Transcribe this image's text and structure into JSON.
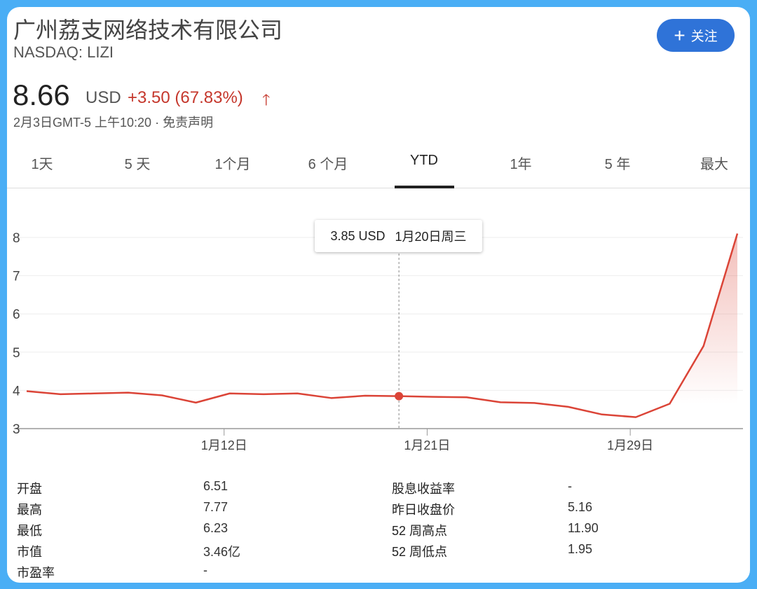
{
  "header": {
    "company": "广州荔支网络技术有限公司",
    "ticker": "NASDAQ: LIZI",
    "price": "8.66",
    "currency": "USD",
    "change": "+3.50 (67.83%)",
    "change_icon": "arrow-up-icon",
    "timestamp": "2月3日GMT-5 上午10:20 · 免责声明",
    "follow_label": "关注",
    "follow_icon": "plus-icon"
  },
  "colors": {
    "accent": "#2f73d8",
    "negative_up": "#c5372c",
    "line": "#db4437",
    "frame": "#4aaef5"
  },
  "tabs": [
    {
      "label": "1天"
    },
    {
      "label": "5 天"
    },
    {
      "label": "1个月"
    },
    {
      "label": "6 个月"
    },
    {
      "label": "YTD",
      "active": true
    },
    {
      "label": "1年"
    },
    {
      "label": "5 年"
    },
    {
      "label": "最大"
    }
  ],
  "tooltip": {
    "price": "3.85 USD",
    "date": "1月20日周三"
  },
  "chart_data": {
    "type": "line",
    "title": "",
    "xlabel": "",
    "ylabel": "",
    "ylim": [
      3,
      8
    ],
    "yticks": [
      "3",
      "4",
      "5",
      "6",
      "7",
      "8"
    ],
    "xticks": [
      {
        "label": "1月12日",
        "index": 6
      },
      {
        "label": "1月21日",
        "index": 12
      },
      {
        "label": "1月29日",
        "index": 18
      }
    ],
    "x": [
      "1/4",
      "1/5",
      "1/6",
      "1/7",
      "1/8",
      "1/11",
      "1/12",
      "1/13",
      "1/14",
      "1/15",
      "1/19",
      "1/20",
      "1/21",
      "1/22",
      "1/25",
      "1/26",
      "1/27",
      "1/28",
      "1/29",
      "2/1",
      "2/2",
      "2/3"
    ],
    "series": [
      {
        "name": "LIZI",
        "values": [
          3.98,
          3.9,
          3.92,
          3.94,
          3.87,
          3.68,
          3.92,
          3.9,
          3.92,
          3.8,
          3.86,
          3.85,
          3.83,
          3.82,
          3.69,
          3.67,
          3.57,
          3.37,
          3.3,
          3.65,
          5.16,
          8.1
        ]
      }
    ],
    "highlight_index": 11,
    "grid": true
  },
  "stats": {
    "left": [
      {
        "label": "开盘",
        "value": "6.51"
      },
      {
        "label": "最高",
        "value": "7.77"
      },
      {
        "label": "最低",
        "value": "6.23"
      },
      {
        "label": "市值",
        "value": "3.46亿"
      },
      {
        "label": "市盈率",
        "value": "-"
      }
    ],
    "right": [
      {
        "label": "股息收益率",
        "value": "-"
      },
      {
        "label": "昨日收盘价",
        "value": "5.16"
      },
      {
        "label": "52 周高点",
        "value": "11.90"
      },
      {
        "label": "52 周低点",
        "value": "1.95"
      }
    ]
  }
}
